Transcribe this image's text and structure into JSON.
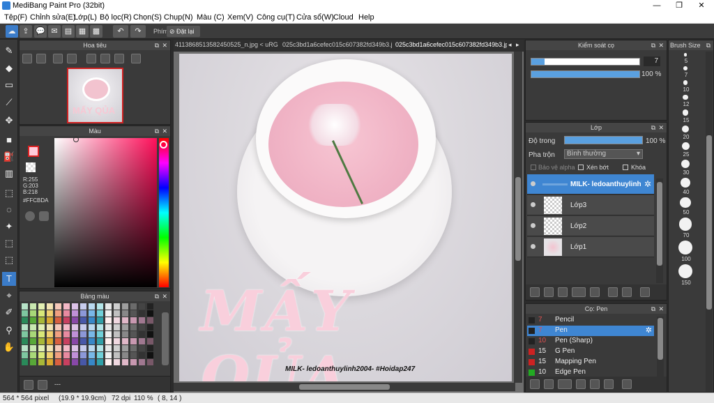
{
  "window": {
    "title": "MediBang Paint Pro (32bit)"
  },
  "menu": [
    "Tệp(F)",
    "Chỉnh sửa(E)",
    "Lớp(L)",
    "Bộ lọc(R)",
    "Chọn(S)",
    "Chụp(N)",
    "Màu (C)",
    "Xem(V)",
    "Công cụ(T)",
    "Cửa sổ(W)",
    "Cloud",
    "Help"
  ],
  "toolbar": {
    "view_label": "Phím",
    "reset_label": "Đặt lại"
  },
  "tabs": [
    "4113868513582450525_n.jpg < uRGB >",
    "025c3bd1a6cefec015c607382fd349b3.jpg",
    "025c3bd1a6cefec015c607382fd349b3.jpg"
  ],
  "navigator": {
    "title": "Hoa tiêu"
  },
  "color": {
    "title": "Màu",
    "r": "R:255",
    "g": "G:203",
    "b": "B:218",
    "hex": "#FFCBDA",
    "accent": "#FFCBDA"
  },
  "palette": {
    "title": "Bảng màu",
    "footer": "---"
  },
  "brush_control": {
    "title": "Kiểm soát cọ",
    "size": "7",
    "opacity": "100 %"
  },
  "layers": {
    "title": "Lớp",
    "opacity_label": "Độ trong",
    "opacity_value": "100 %",
    "blend_label": "Pha trộn",
    "blend_value": "Bình thường",
    "protect_alpha": "Bảo vệ alpha",
    "clipping": "Xén bớt",
    "lock": "Khóa",
    "items": [
      {
        "name": "MILK- ledoanthuylinh"
      },
      {
        "name": "Lớp3"
      },
      {
        "name": "Lớp2"
      },
      {
        "name": "Lớp1"
      }
    ]
  },
  "brushes": {
    "title": "Cọ: Pen",
    "items": [
      {
        "size": "7",
        "name": "Pencil",
        "color": "#222222"
      },
      {
        "size": "7",
        "name": "Pen",
        "color": "#222222"
      },
      {
        "size": "10",
        "name": "Pen (Sharp)",
        "color": "#222222"
      },
      {
        "size": "15",
        "name": "G Pen",
        "color": "#cc2222"
      },
      {
        "size": "15",
        "name": "Mapping Pen",
        "color": "#cc2222"
      },
      {
        "size": "10",
        "name": "Edge Pen",
        "color": "#22aa22"
      }
    ]
  },
  "brush_size": {
    "title": "Brush Size",
    "sizes": [
      "5",
      "7",
      "10",
      "12",
      "15",
      "20",
      "25",
      "30",
      "40",
      "50",
      "70",
      "100",
      "150"
    ]
  },
  "artwork": {
    "title_text": "MẤY QỦA",
    "caption": "MILK- ledoanthuylinh2004- #Hoidap247"
  },
  "status": {
    "size": "564 * 564 pixel",
    "cm": "(19.9 * 19.9cm)",
    "dpi": "72 dpi",
    "zoom": "110 %",
    "pos": "( 8, 14 )"
  }
}
